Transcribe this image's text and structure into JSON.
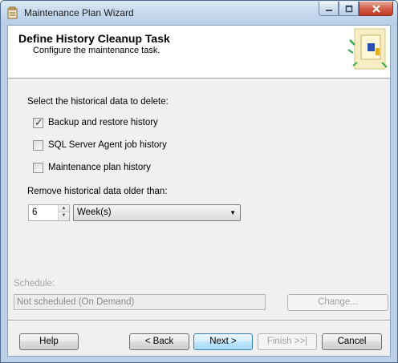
{
  "window": {
    "title": "Maintenance Plan Wizard"
  },
  "header": {
    "title": "Define History Cleanup Task",
    "subtitle": "Configure the maintenance task."
  },
  "content": {
    "section_label": "Select the historical data to delete:",
    "checkboxes": [
      {
        "label": "Backup and restore history",
        "checked": true
      },
      {
        "label": "SQL Server Agent job history",
        "checked": false
      },
      {
        "label": "Maintenance plan history",
        "checked": false
      }
    ],
    "older_than_label": "Remove historical data older than:",
    "age_value": "6",
    "age_unit": "Week(s)"
  },
  "schedule": {
    "label": "Schedule:",
    "value": "Not scheduled (On Demand)",
    "change_label": "Change..."
  },
  "footer": {
    "help": "Help",
    "back": "< Back",
    "next": "Next >",
    "finish": "Finish >>|",
    "cancel": "Cancel"
  }
}
